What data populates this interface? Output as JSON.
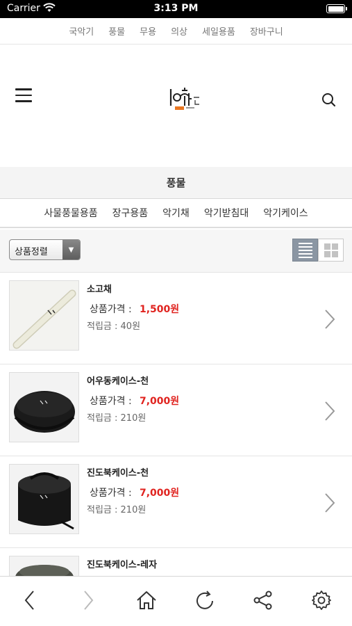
{
  "status_bar": {
    "carrier": "Carrier",
    "time": "3:13 PM"
  },
  "top_menu": [
    "국악기",
    "풍물",
    "무용",
    "의상",
    "세일용품",
    "장바구니"
  ],
  "category": {
    "title": "풍물"
  },
  "sub_tabs": [
    "사물풍물용품",
    "장구용품",
    "악기채",
    "악기받침대",
    "악기케이스"
  ],
  "sort": {
    "label": "상품정렬"
  },
  "products": [
    {
      "name": "소고채",
      "price_label": "상품가격 :",
      "price": "1,500원",
      "points": "적립금 : 40원"
    },
    {
      "name": "어우동케이스-천",
      "price_label": "상품가격 :",
      "price": "7,000원",
      "points": "적립금 : 210원"
    },
    {
      "name": "진도북케이스-천",
      "price_label": "상품가격 :",
      "price": "7,000원",
      "points": "적립금 : 210원"
    },
    {
      "name": "진도북케이스-레자",
      "price_label": "",
      "price": "",
      "points": ""
    }
  ],
  "icons": {
    "menu": "hamburger-icon",
    "search": "search-icon",
    "chevron": "chevron-right-icon",
    "back": "chevron-left-icon",
    "forward": "chevron-right-icon",
    "home": "home-icon",
    "reload": "reload-icon",
    "share": "share-icon",
    "settings": "gear-icon"
  },
  "colors": {
    "price": "#e0231f",
    "view_active": "#8b96a3",
    "logo_accent": "#e87722"
  }
}
